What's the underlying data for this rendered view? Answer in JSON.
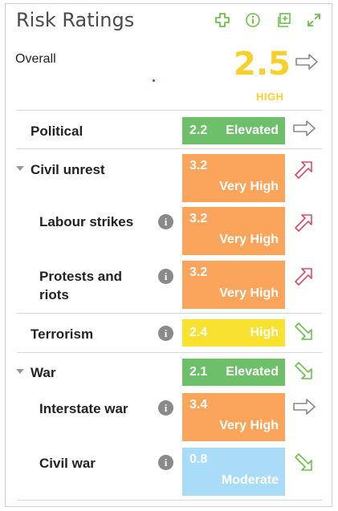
{
  "title": "Risk Ratings",
  "toolbar": {
    "icons": [
      "plus-icon",
      "info-icon",
      "add-window-icon",
      "expand-icon"
    ],
    "color": "#6cc04a"
  },
  "overall": {
    "label": "Overall",
    "score": "2.5",
    "level": "HIGH",
    "trend": "stable"
  },
  "colors": {
    "Elevated": "#6dbf6a",
    "Very High": "#fba55c",
    "High": "#f8e12f",
    "Moderate": "#a9dcf8",
    "trend_up": "#d94c66",
    "trend_down": "#6cc04a",
    "trend_stable": "#888888"
  },
  "rows": [
    {
      "label": "Political",
      "score": "2.2",
      "level": "Elevated",
      "trend": "stable"
    },
    {
      "label": "Civil unrest",
      "score": "3.2",
      "level": "Very High",
      "trend": "up"
    },
    {
      "label": "Labour strikes",
      "score": "3.2",
      "level": "Very High",
      "trend": "up"
    },
    {
      "label": "Protests and riots",
      "score": "3.2",
      "level": "Very High",
      "trend": "up"
    },
    {
      "label": "Terrorism",
      "score": "2.4",
      "level": "High",
      "trend": "down"
    },
    {
      "label": "War",
      "score": "2.1",
      "level": "Elevated",
      "trend": "down"
    },
    {
      "label": "Interstate war",
      "score": "3.4",
      "level": "Very High",
      "trend": "stable"
    },
    {
      "label": "Civil war",
      "score": "0.8",
      "level": "Moderate",
      "trend": "down"
    }
  ]
}
